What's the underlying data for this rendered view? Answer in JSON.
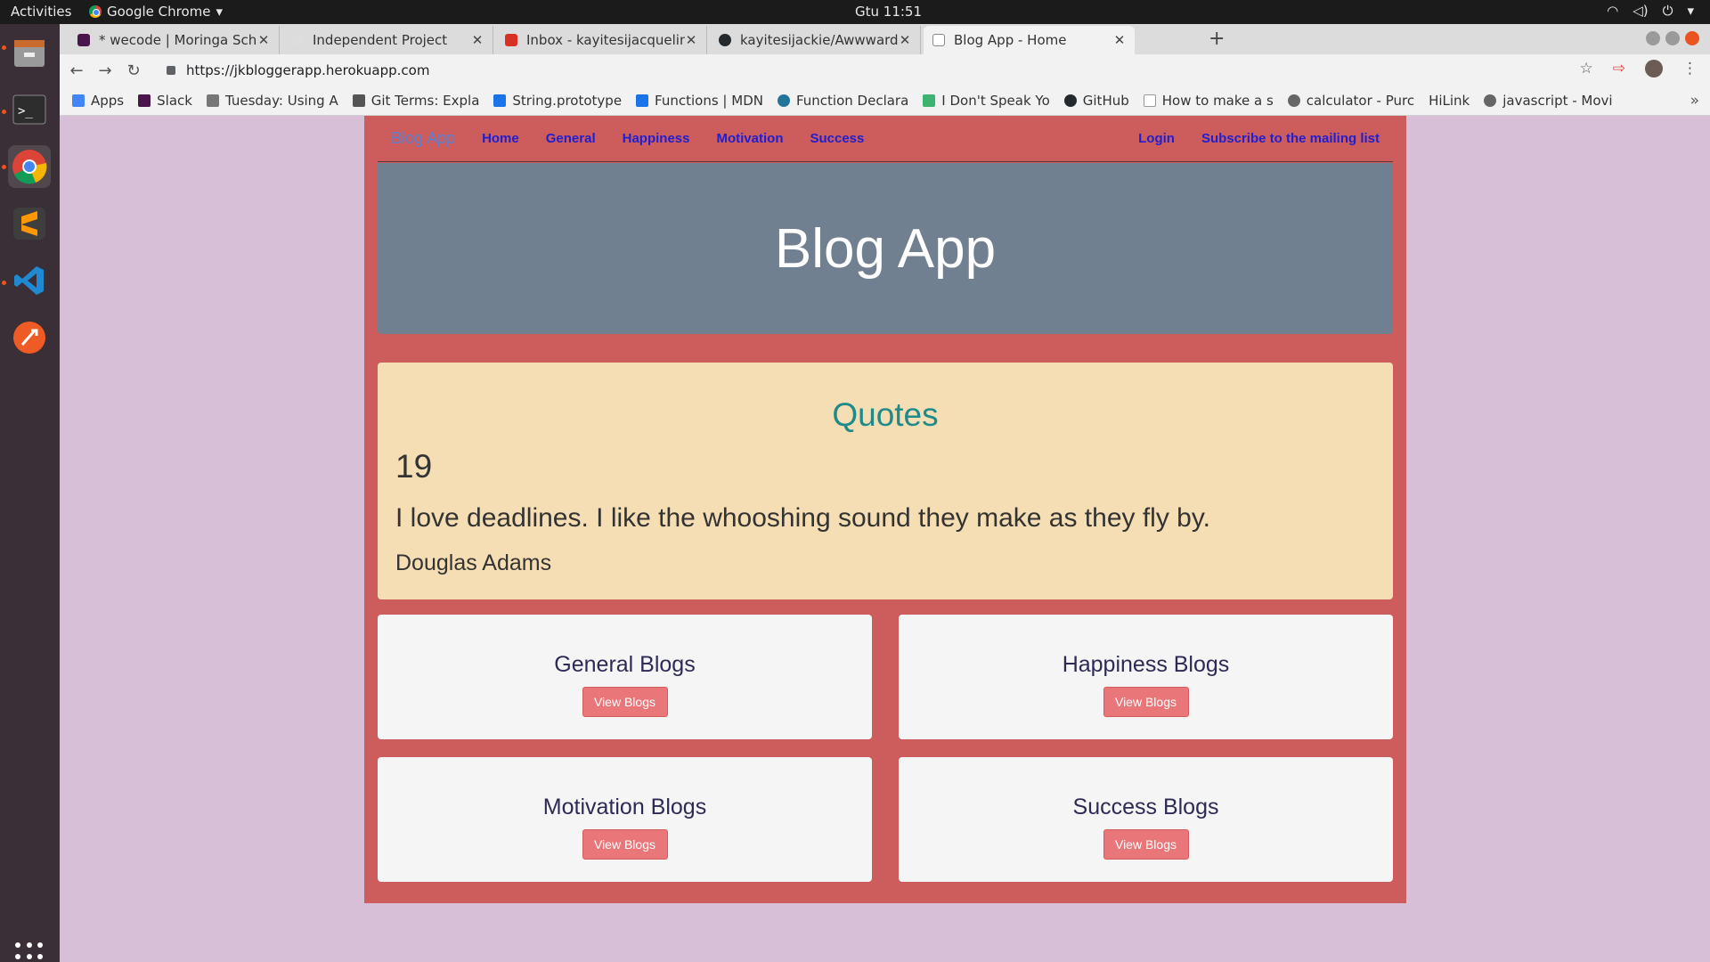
{
  "system": {
    "activities": "Activities",
    "app_name": "Google Chrome",
    "clock": "Gtu 11:51"
  },
  "tabs": [
    {
      "title": "* wecode | Moringa Schoo",
      "favicon_color": "#4a154b"
    },
    {
      "title": "Independent Project",
      "favicon_color": "#dddddd"
    },
    {
      "title": "Inbox - kayitesijacqueline",
      "favicon_color": "#d93025"
    },
    {
      "title": "kayitesijackie/Awwward-",
      "favicon_color": "#24292e"
    },
    {
      "title": "Blog App - Home",
      "favicon_color": "#888888"
    }
  ],
  "address_bar": {
    "url": "https://jkbloggerapp.herokuapp.com"
  },
  "bookmarks": [
    {
      "label": "Apps",
      "color": "#4285f4"
    },
    {
      "label": "Slack",
      "color": "#4a154b"
    },
    {
      "label": "Tuesday: Using A",
      "color": "#777777"
    },
    {
      "label": "Git Terms: Expla",
      "color": "#555555"
    },
    {
      "label": "String.prototype",
      "color": "#1a73e8"
    },
    {
      "label": "Functions | MDN",
      "color": "#1a73e8"
    },
    {
      "label": "Function Declara",
      "color": "#21759b"
    },
    {
      "label": "I Don't Speak Yo",
      "color": "#3cb371"
    },
    {
      "label": "GitHub",
      "color": "#24292e"
    },
    {
      "label": "How to make a s",
      "color": "#999999"
    },
    {
      "label": "calculator - Purc",
      "color": "#666666"
    },
    {
      "label": "HiLink",
      "color": "#f2f2f2"
    },
    {
      "label": "javascript - Movi",
      "color": "#666666"
    }
  ],
  "page": {
    "nav": {
      "brand": "Blog App",
      "links": [
        "Home",
        "General",
        "Happiness",
        "Motivation",
        "Success"
      ],
      "login": "Login",
      "subscribe": "Subscribe to the mailing list"
    },
    "jumbotron_title": "Blog App",
    "quotes": {
      "heading": "Quotes",
      "id": "19",
      "text": "I love deadlines. I like the whooshing sound they make as they fly by.",
      "author": "Douglas Adams"
    },
    "cards": [
      {
        "title": "General Blogs",
        "button": "View Blogs"
      },
      {
        "title": "Happiness Blogs",
        "button": "View Blogs"
      },
      {
        "title": "Motivation Blogs",
        "button": "View Blogs"
      },
      {
        "title": "Success Blogs",
        "button": "View Blogs"
      }
    ]
  },
  "colors": {
    "page_bg": "#d8bfd8",
    "container_bg": "#cd5c5c",
    "jumbotron_bg": "#708090",
    "quote_bg": "#f5deb3",
    "button_bg": "#e9777a"
  }
}
